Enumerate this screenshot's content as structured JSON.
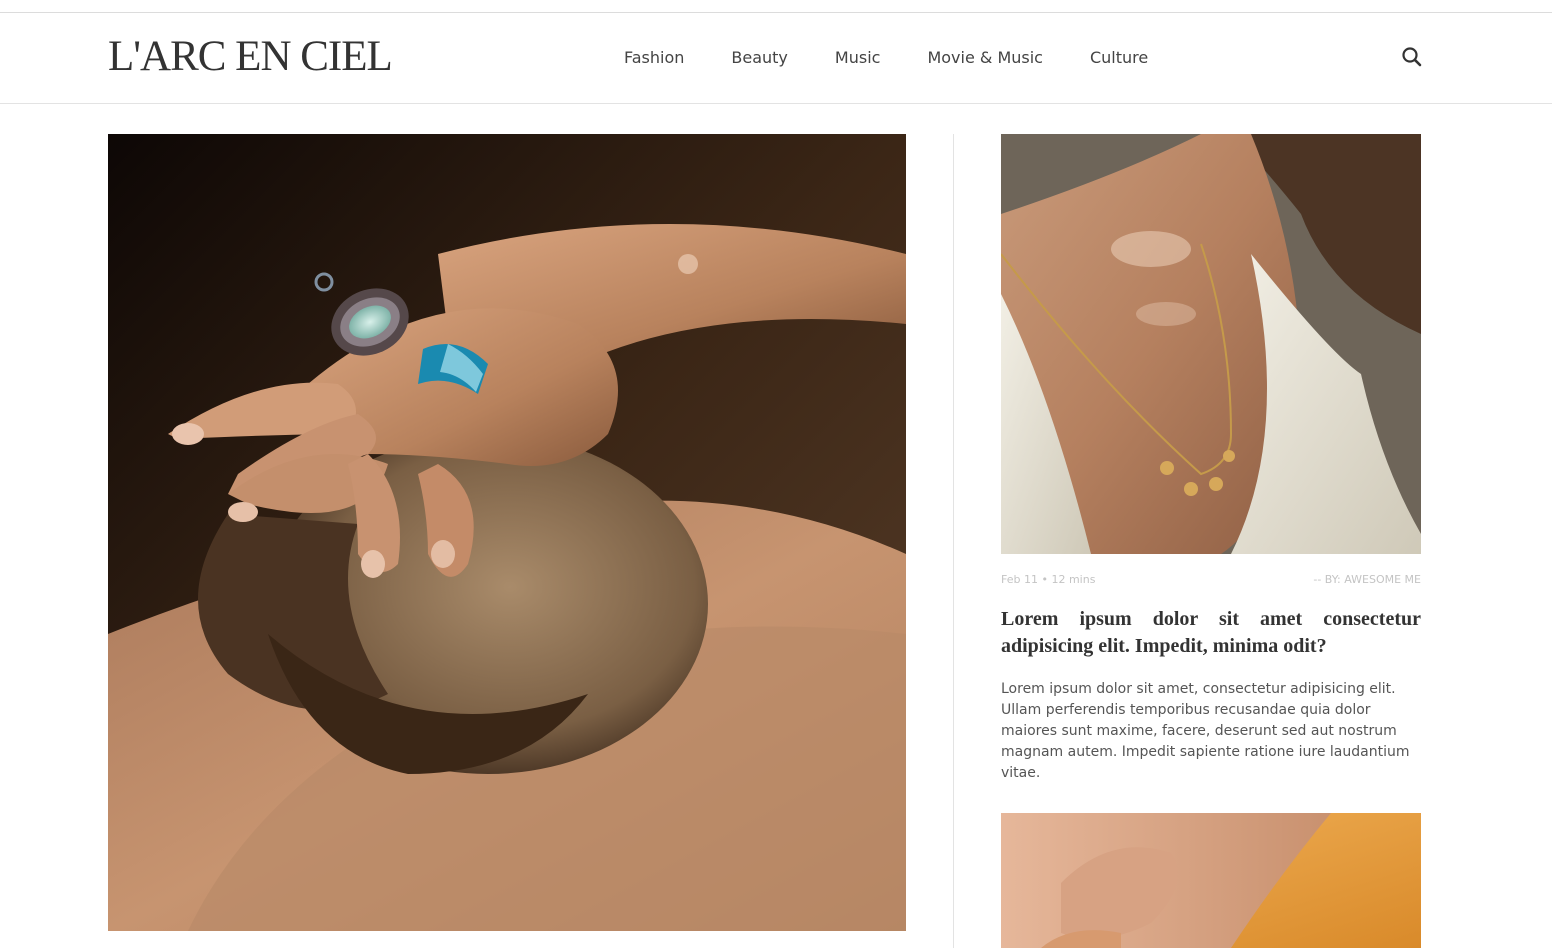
{
  "header": {
    "logo": "L'ARC EN CIEL",
    "nav": [
      "Fashion",
      "Beauty",
      "Music",
      "Movie & Music",
      "Culture"
    ]
  },
  "post": {
    "date_time": "Feb 11 • 12 mins",
    "author": "-- BY: AWESOME ME",
    "title": "Lorem ipsum dolor sit amet consectetur adipisicing elit. Impedit, minima odit?",
    "excerpt": "Lorem ipsum dolor sit amet, consectetur adipisicing elit. Ullam perferendis temporibus recusandae quia dolor maiores sunt maxime, facere, deserunt sed aut nostrum magnam autem. Impedit sapiente ratione iure laudantium vitae."
  },
  "icons": {
    "search": "search-icon"
  },
  "colors": {
    "text_dark": "#333333",
    "text_meta": "#c4c4c4",
    "divider": "#e3e3e3"
  }
}
